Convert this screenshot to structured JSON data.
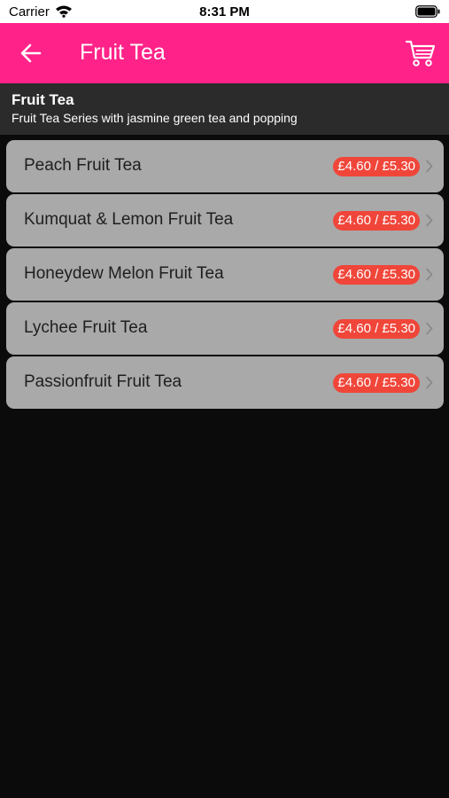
{
  "status_bar": {
    "carrier": "Carrier",
    "time": "8:31 PM"
  },
  "nav": {
    "title": "Fruit Tea",
    "back_icon": "arrow-left-icon",
    "cart_icon": "cart-icon"
  },
  "category": {
    "title": "Fruit Tea",
    "subtitle": "Fruit Tea Series with jasmine green tea and popping"
  },
  "items": [
    {
      "name": "Peach Fruit Tea",
      "price": "£4.60 / £5.30"
    },
    {
      "name": "Kumquat & Lemon Fruit Tea",
      "price": "£4.60 / £5.30"
    },
    {
      "name": "Honeydew Melon Fruit Tea",
      "price": "£4.60 / £5.30"
    },
    {
      "name": "Lychee Fruit Tea",
      "price": "£4.60 / £5.30"
    },
    {
      "name": "Passionfruit Fruit Tea",
      "price": "£4.60 / £5.30"
    }
  ],
  "colors": {
    "nav_background": "#ff2288",
    "page_background": "#0b0b0b",
    "category_background": "#2b2b2b",
    "item_background": "#a9a9a9",
    "price_badge": "#f0463a"
  }
}
